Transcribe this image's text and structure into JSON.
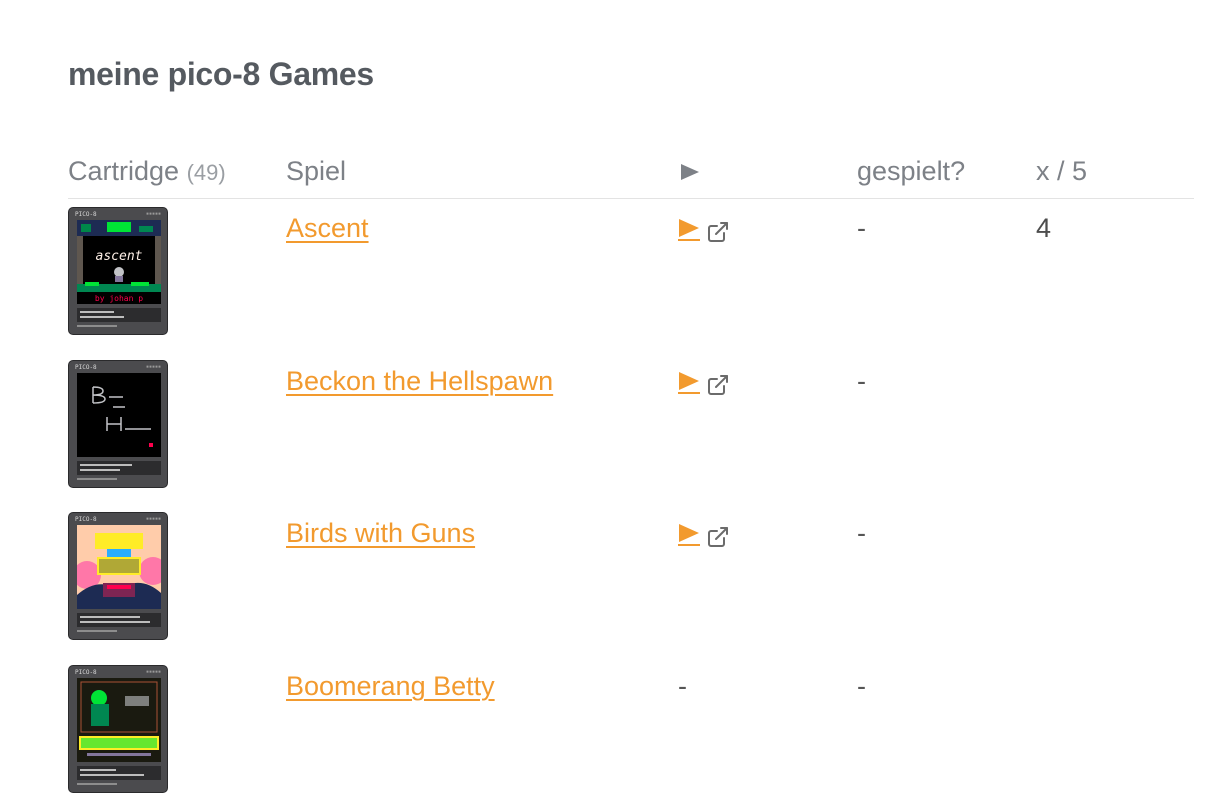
{
  "page": {
    "title": "meine pico-8 Games"
  },
  "table": {
    "headers": {
      "cartridge": "Cartridge",
      "count": "(49)",
      "game": "Spiel",
      "play_icon": "play-triangle-icon",
      "played": "gespielt?",
      "rating": "x / 5"
    },
    "rows": [
      {
        "name": "Ascent",
        "has_play": true,
        "played": "-",
        "rating": "4",
        "no_play_text": ""
      },
      {
        "name": "Beckon the Hellspawn",
        "has_play": true,
        "played": "-",
        "rating": "",
        "no_play_text": ""
      },
      {
        "name": "Birds with Guns",
        "has_play": true,
        "played": "-",
        "rating": "",
        "no_play_text": ""
      },
      {
        "name": "Boomerang Betty",
        "has_play": false,
        "played": "-",
        "rating": "",
        "no_play_text": "-"
      }
    ]
  },
  "cartridge": {
    "brand": "PICO-8"
  },
  "colors": {
    "accent": "#f29a2e",
    "heading": "#555a60",
    "header_text": "#7d8187",
    "divider": "#e3e3e3"
  }
}
